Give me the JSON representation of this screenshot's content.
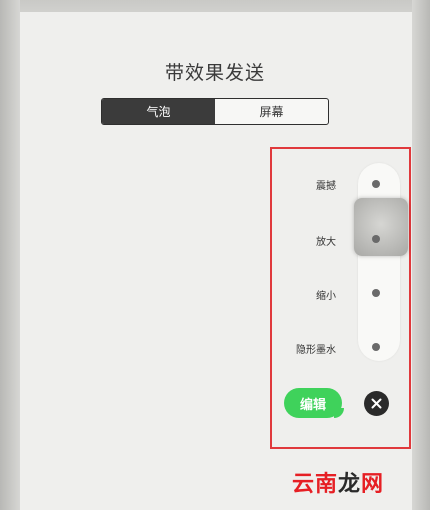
{
  "sheet": {
    "title": "带效果发送"
  },
  "segments": [
    {
      "label": "气泡",
      "selected": true
    },
    {
      "label": "屏幕",
      "selected": false
    }
  ],
  "effects": [
    {
      "label": "震撼"
    },
    {
      "label": "放大"
    },
    {
      "label": "缩小"
    },
    {
      "label": "隐形墨水"
    }
  ],
  "message": {
    "text": "编辑",
    "bubble_color": "#3fd25b"
  },
  "close": {
    "icon": "close-icon"
  },
  "watermark": {
    "part1": "云南",
    "part2": "龙",
    "part3": "网"
  },
  "colors": {
    "accent_red": "#e0393c",
    "segment_active": "#3b3b3b"
  }
}
